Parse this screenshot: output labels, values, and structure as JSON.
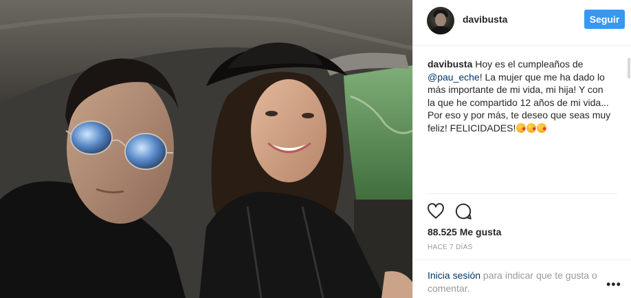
{
  "post": {
    "username": "davibusta",
    "follow_label": "Seguir",
    "caption": {
      "username": "davibusta",
      "text_part1": " Hoy es el cumpleaños de ",
      "mention": "@pau_eche",
      "text_part2": "! La mujer que me ha dado lo más importante de mi vida, mi hija! Y con la que he compartido 12 años de mi vida... Por eso y por más, te deseo que seas muy feliz! FELICIDADES!",
      "emojis": [
        "kiss-emoji",
        "kiss-emoji",
        "kiss-emoji"
      ]
    },
    "likes": "88.525 Me gusta",
    "timestamp": "HACE 7 DÍAS",
    "login_link": "Inicia sesión",
    "login_text": " para indicar que te gusta o comentar.",
    "more_label": "•••"
  },
  "icons": {
    "like": "heart-icon",
    "comment": "comment-icon",
    "more": "more-options-icon"
  },
  "colors": {
    "follow_button": "#3897f0",
    "link": "#003569",
    "muted": "#999999"
  }
}
